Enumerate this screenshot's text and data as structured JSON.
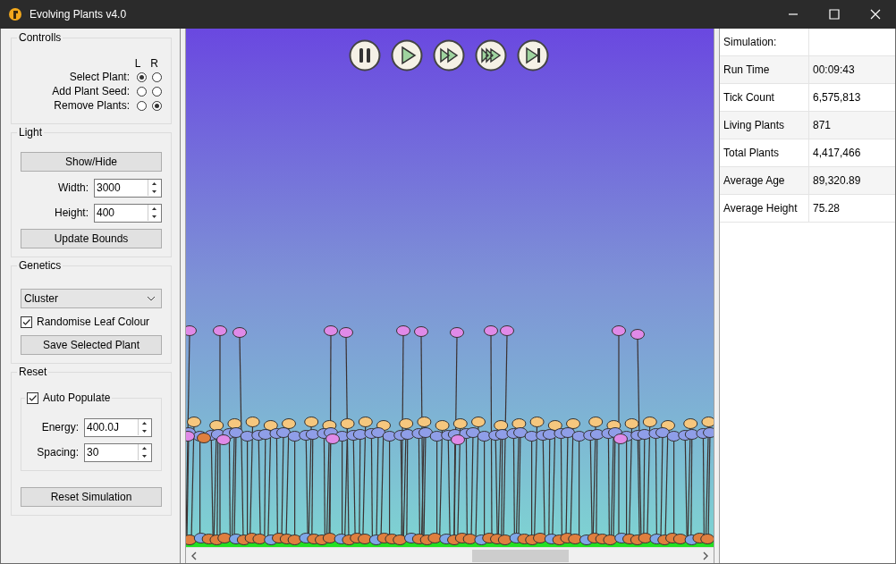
{
  "window": {
    "title": "Evolving Plants v4.0"
  },
  "controls": {
    "title": "Controlls",
    "columns": [
      "L",
      "R"
    ],
    "rows": [
      {
        "label": "Select Plant:",
        "options": [
          {
            "selected": true
          },
          {
            "selected": false
          }
        ]
      },
      {
        "label": "Add Plant Seed:",
        "options": [
          {
            "selected": false
          },
          {
            "selected": false
          }
        ]
      },
      {
        "label": "Remove Plants:",
        "options": [
          {
            "selected": false
          },
          {
            "selected": true
          }
        ]
      }
    ]
  },
  "light": {
    "title": "Light",
    "show_button": "Show/Hide",
    "fields": [
      {
        "label": "Width:",
        "value": "3000"
      },
      {
        "label": "Height:",
        "value": "400"
      }
    ],
    "update_button": "Update Bounds"
  },
  "genetics": {
    "title": "Genetics",
    "dropdown": "Cluster",
    "checkbox": {
      "label": "Randomise Leaf Colour",
      "checked": true
    },
    "button": "Save Selected Plant"
  },
  "reset": {
    "title": "Reset",
    "auto_populate": {
      "label": "Auto Populate",
      "checked": true
    },
    "fields": [
      {
        "label": "Energy:",
        "value": "400.0J"
      },
      {
        "label": "Spacing:",
        "value": "30"
      }
    ],
    "button": "Reset Simulation"
  },
  "playback_buttons": [
    {
      "kind": "pause"
    },
    {
      "kind": "play"
    },
    {
      "kind": "fast"
    },
    {
      "kind": "faster"
    },
    {
      "kind": "step"
    }
  ],
  "stats": {
    "heading": "Simulation:",
    "rows": [
      {
        "label": "Run Time",
        "value": "00:09:43"
      },
      {
        "label": "Tick Count",
        "value": "6,575,813"
      },
      {
        "label": "Living Plants",
        "value": "871"
      },
      {
        "label": "Total Plants",
        "value": "4,417,466"
      },
      {
        "label": "Average Age",
        "value": "89,320.89"
      },
      {
        "label": "Average Height",
        "value": "75.28"
      }
    ]
  }
}
